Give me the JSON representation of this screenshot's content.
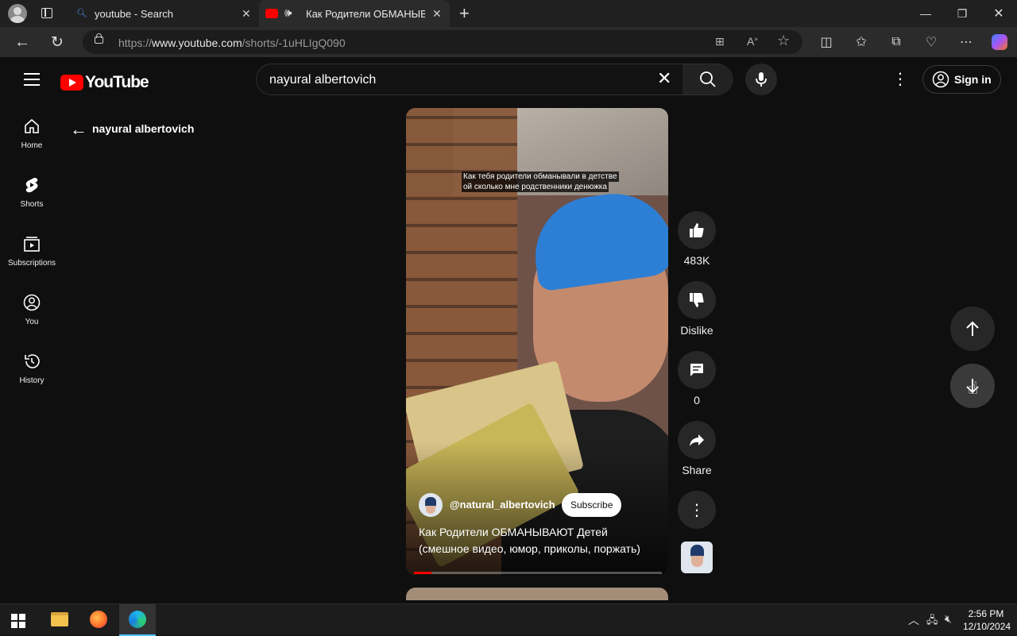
{
  "browser": {
    "tabs": [
      {
        "title": "youtube - Search"
      },
      {
        "title": "Как Родители ОБМАНЫВАЮ"
      }
    ],
    "url_prefix": "https://",
    "url_domain": "www.youtube.com",
    "url_path": "/shorts/-1uHLIgQ090"
  },
  "youtube": {
    "logo_text": "YouTube",
    "search_query": "nayural albertovich",
    "signin_label": "Sign in",
    "sidebar": [
      {
        "label": "Home",
        "icon": "home-icon"
      },
      {
        "label": "Shorts",
        "icon": "shorts-icon"
      },
      {
        "label": "Subscriptions",
        "icon": "subscriptions-icon"
      },
      {
        "label": "You",
        "icon": "you-icon"
      },
      {
        "label": "History",
        "icon": "history-icon"
      }
    ],
    "back_title": "nayural albertovich"
  },
  "short": {
    "overlay_line1": "Как тебя родители обманывали в детстве",
    "overlay_line2": "ой сколько мне родственники денюжка",
    "channel": "@natural_albertovich",
    "subscribe_label": "Subscribe",
    "title_line1": "Как Родители ОБМАНЫВАЮТ Детей",
    "title_line2": "(смешное видео, юмор, приколы, поржать)",
    "progress": 0.07,
    "likes": "483K",
    "dislike_label": "Dislike",
    "comments": "0",
    "share_label": "Share"
  },
  "taskbar": {
    "time": "2:56 PM",
    "date": "12/10/2024"
  },
  "colors": {
    "accent_red": "#ff0000",
    "background": "#0f0f0f",
    "button_bg": "#272727"
  }
}
